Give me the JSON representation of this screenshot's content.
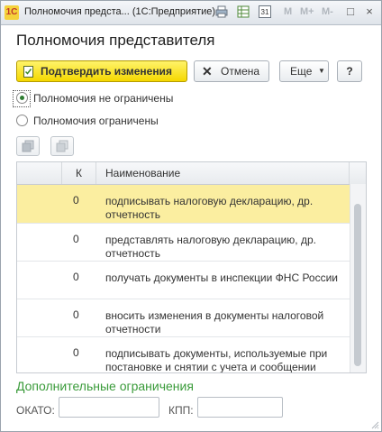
{
  "window": {
    "title": "Полномочия предста... (1С:Предприятие)",
    "app_icon_text": "1С",
    "toolbar_m": [
      "M",
      "M+",
      "M-"
    ],
    "calendar_icon_text": "31"
  },
  "form": {
    "title": "Полномочия представителя",
    "buttons": {
      "confirm_label": "Подтвердить изменения",
      "cancel_label": "Отмена",
      "more_label": "Еще",
      "help_label": "?"
    },
    "radio_options": [
      {
        "label": "Полномочия не ограничены",
        "checked": true
      },
      {
        "label": "Полномочия ограничены",
        "checked": false
      }
    ],
    "table": {
      "columns": [
        "",
        "К",
        "Наименование"
      ],
      "rows": [
        {
          "k": "0",
          "name": "подписывать налоговую декларацию, др. отчетность",
          "selected": true
        },
        {
          "k": "0",
          "name": "представлять налоговую декларацию, др. отчетность",
          "selected": false
        },
        {
          "k": "0",
          "name": "получать документы в инспекции ФНС России",
          "selected": false
        },
        {
          "k": "0",
          "name": "вносить изменения в документы налоговой отчетности",
          "selected": false
        },
        {
          "k": "0",
          "name": "подписывать документы, используемые при постановке и снятии с учета и сообщении",
          "selected": false
        }
      ]
    },
    "additional": {
      "title": "Дополнительные ограничения",
      "okato_label": "ОКАТО:",
      "okato_value": "",
      "kpp_label": "КПП:",
      "kpp_value": ""
    }
  },
  "colors": {
    "accent_green": "#3a9b3a",
    "primary_button": "#f5d800",
    "selected_row": "#fbeea0"
  }
}
